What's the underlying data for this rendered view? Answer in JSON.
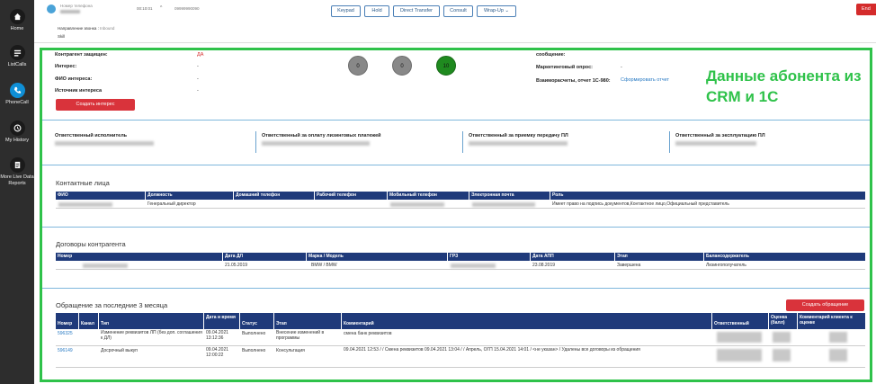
{
  "sidebar": {
    "items": [
      {
        "label": "Home",
        "icon": "home-icon"
      },
      {
        "label": "ListCalls",
        "icon": "list-calls-icon"
      },
      {
        "label": "PhoneCall",
        "icon": "phone-icon"
      },
      {
        "label": "My History",
        "icon": "history-icon"
      },
      {
        "label": "More Live Data Reports",
        "icon": "reports-icon"
      }
    ]
  },
  "header": {
    "caller_label": "Номер телефона",
    "timer": "00:10:01",
    "dropdown": "^",
    "number": "09999990090",
    "buttons": [
      "Keypad",
      "Hold",
      "Direct Transfer",
      "Consult",
      "Wrap-Up ⌄"
    ],
    "end": "End",
    "direction_label": "Направление звонка :",
    "direction_value": "Inbound",
    "skill_label": "Skill"
  },
  "info": {
    "protected_label": "Контрагент защищен:",
    "protected_value": "ДА",
    "interest_label": "Интерес:",
    "interest_value": "-",
    "fio_label": "ФИО интереса:",
    "fio_value": "-",
    "source_label": "Источник интереса",
    "source_value": "-",
    "create_interest": "Создать интерес",
    "counters": [
      "0",
      "0",
      "10"
    ],
    "message_label": "сообщение:",
    "survey_label": "Маркетинговый опрос:",
    "survey_value": "-",
    "settlements_label": "Взаиморасчеты, отчет 1С-980:",
    "settlements_value": "Сформировать отчет",
    "annotation": "Данные абонента из CRM и 1С"
  },
  "responsible": [
    "Ответственный исполнитель",
    "Ответственный за оплату лизинговых платежей",
    "Ответственный за приемку передачу ПЛ",
    "Ответственный за эксплуатацию ПЛ"
  ],
  "contacts": {
    "title": "Контактные лица",
    "headers": [
      "ФИО",
      "Должность",
      "Домашний телефон",
      "Рабочий телефон",
      "Мобильный телефон",
      "Электронная почта",
      "Роль"
    ],
    "rows": [
      [
        "",
        "Генеральный директор",
        "",
        "",
        "",
        "",
        "Имеет право на подпись документов,Контактное лицо,Официальный представитель"
      ]
    ]
  },
  "contracts": {
    "title": "Договоры контрагента",
    "headers": [
      "Номер",
      "Дата ДЛ",
      "Марка / Модель",
      "ГРЗ",
      "Дата АПП",
      "Этап",
      "Балансодержатель"
    ],
    "rows": [
      [
        "",
        "21.05.2019",
        "BMW / BMW",
        "",
        "23.08.2019",
        "Завершена",
        "Лизингополучатель"
      ]
    ]
  },
  "appeals": {
    "title": "Обращение за последние 3 месяца",
    "create_button": "Создать обращение",
    "headers": [
      "Номер",
      "Канал",
      "Тип",
      "Дата и время",
      "Статус",
      "Этап",
      "Комментарий",
      "Ответственный",
      "Оценка (балл)",
      "Комментарий клиента к оценке"
    ],
    "rows": [
      {
        "number": "596325",
        "channel": "",
        "type": "Изменение реквизитов ЛП (без доп. соглашения к ДЛ)",
        "date": "09.04.2021 13:12:36",
        "status": "Выполнено",
        "stage": "Внесение изменений в программы",
        "comment": "смена банк реквизитов"
      },
      {
        "number": "596149",
        "channel": "",
        "type": "Досрочный выкуп",
        "date": "09.04.2021 12:00:22",
        "status": "Выполнено",
        "stage": "Консультация",
        "comment": "09.04.2021 12:53 / / Смена реквизитов 09.04.2021 13:04 / / Апрель, ОГП 15.04.2021 14:01 / <не указан> / Удалены все договоры из обращения"
      }
    ]
  }
}
